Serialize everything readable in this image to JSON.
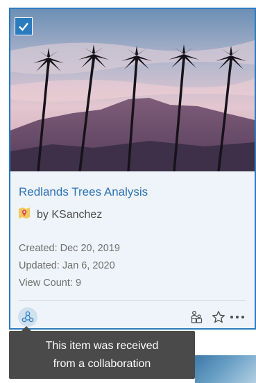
{
  "card": {
    "title": "Redlands Trees Analysis",
    "owner": "by KSanchez",
    "created": "Created: Dec 20, 2019",
    "updated": "Updated: Jan 6, 2020",
    "view_count": "View Count: 9",
    "selected": true,
    "item_type_icon": "web-map-icon",
    "thumbnail_icon": "palm-trees-mountain-thumbnail"
  },
  "actions": [
    "collaboration-icon",
    "share-icon",
    "favorite-icon",
    "more-options-icon"
  ],
  "tooltip": {
    "line1": "This item was received",
    "line2": "from a collaboration"
  },
  "colors": {
    "accent": "#2b7bbf",
    "title_link": "#2f73b3",
    "tooltip_bg": "#4a4a4a",
    "info_bg": "#eef4f9"
  }
}
